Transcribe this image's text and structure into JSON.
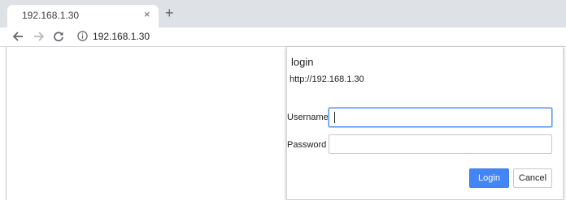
{
  "browser": {
    "tab": {
      "title": "192.168.1.30",
      "close_glyph": "×"
    },
    "new_tab_glyph": "+",
    "toolbar": {
      "back_icon": "back-arrow-icon",
      "forward_icon": "forward-arrow-icon",
      "reload_icon": "reload-icon",
      "site_info_icon": "info-icon",
      "url": "192.168.1.30"
    }
  },
  "dialog": {
    "title": "login",
    "origin": "http://192.168.1.30",
    "username_label": "Username",
    "username_value": "",
    "password_label": "Password",
    "password_value": "",
    "login_button": "Login",
    "cancel_button": "Cancel"
  },
  "colors": {
    "accent": "#4285f4",
    "focus_border": "#4d90fe",
    "tabstrip": "#dee1e6"
  }
}
